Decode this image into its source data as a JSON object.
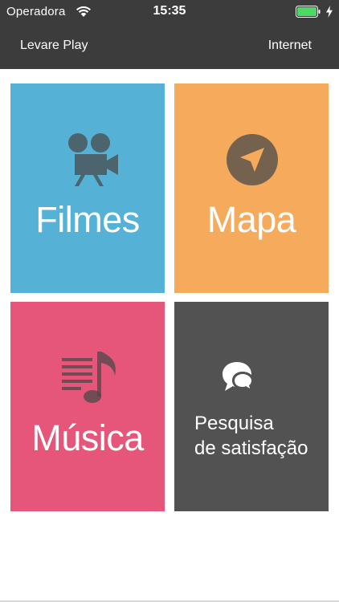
{
  "status_bar": {
    "carrier": "Operadora",
    "time": "15:35",
    "wifi_icon": "wifi-icon",
    "battery_icon": "battery-icon",
    "charging_icon": "lightning-icon"
  },
  "nav": {
    "left_label": "Levare Play",
    "right_label": "Internet"
  },
  "tiles": [
    {
      "label": "Filmes",
      "icon": "movie-camera-icon",
      "color": "#55b2d6"
    },
    {
      "label": "Mapa",
      "icon": "navigation-arrow-icon",
      "color": "#f6ab5c"
    },
    {
      "label": "Música",
      "icon": "music-note-icon",
      "color": "#e5567a"
    },
    {
      "label_line1": "Pesquisa",
      "label_line2": "de satisfação",
      "icon": "chat-bubbles-icon",
      "color": "#525252"
    }
  ],
  "colors": {
    "topbar": "#3c3c3c",
    "battery_fill": "#4cd964",
    "icon_overlay": "#4a4a4a"
  }
}
